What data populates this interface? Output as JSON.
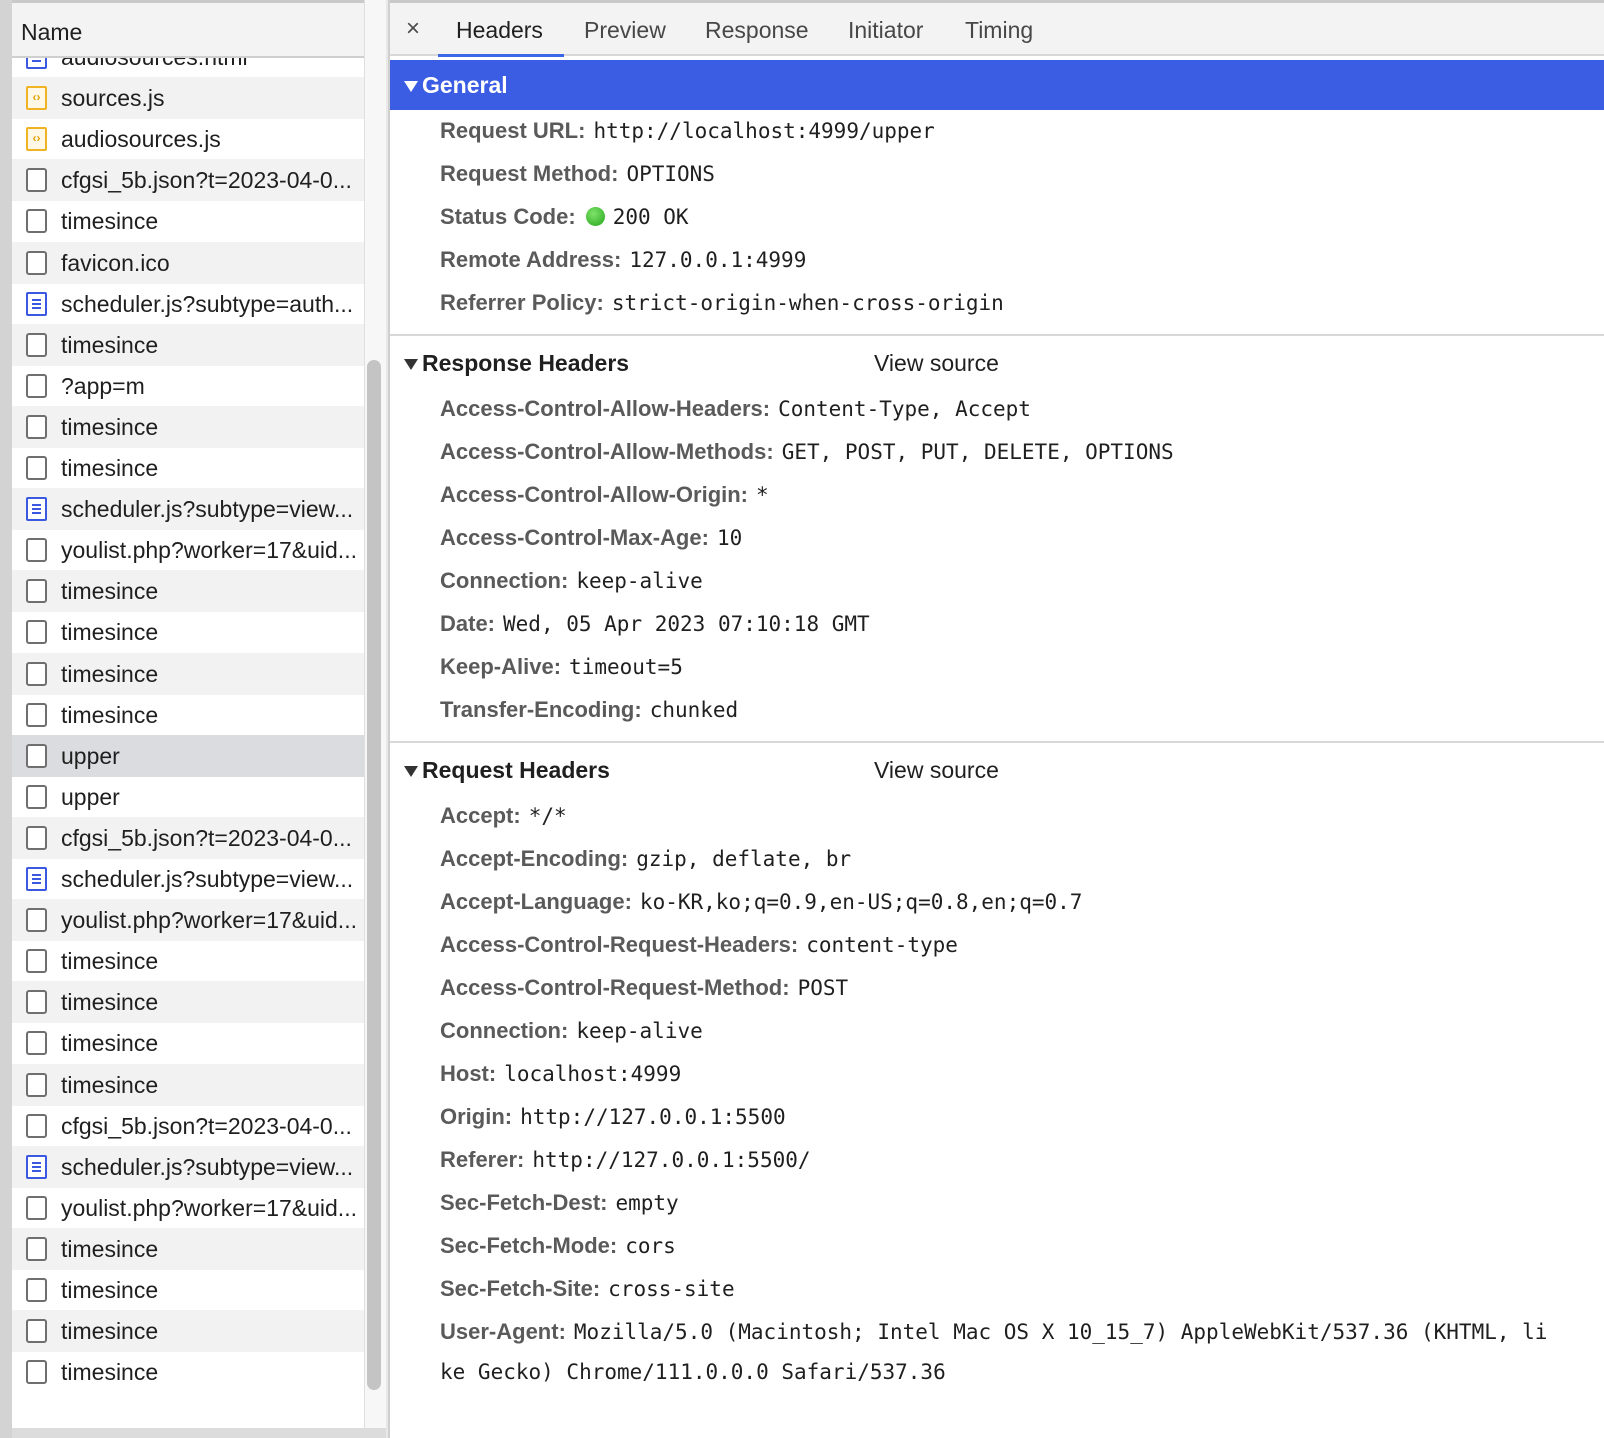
{
  "request_list": {
    "column_header": "Name",
    "rows": [
      {
        "name": "audiosources.html",
        "icon": "document-icon"
      },
      {
        "name": "sources.js",
        "icon": "script-icon"
      },
      {
        "name": "audiosources.js",
        "icon": "script-icon"
      },
      {
        "name": "cfgsi_5b.json?t=2023-04-0...",
        "icon": "blank-file-icon"
      },
      {
        "name": "timesince",
        "icon": "blank-file-icon"
      },
      {
        "name": "favicon.ico",
        "icon": "blank-file-icon"
      },
      {
        "name": "scheduler.js?subtype=auth...",
        "icon": "document-icon"
      },
      {
        "name": "timesince",
        "icon": "blank-file-icon"
      },
      {
        "name": "?app=m",
        "icon": "blank-file-icon"
      },
      {
        "name": "timesince",
        "icon": "blank-file-icon"
      },
      {
        "name": "timesince",
        "icon": "blank-file-icon"
      },
      {
        "name": "scheduler.js?subtype=view...",
        "icon": "document-icon"
      },
      {
        "name": "youlist.php?worker=17&uid...",
        "icon": "blank-file-icon"
      },
      {
        "name": "timesince",
        "icon": "blank-file-icon"
      },
      {
        "name": "timesince",
        "icon": "blank-file-icon"
      },
      {
        "name": "timesince",
        "icon": "blank-file-icon"
      },
      {
        "name": "timesince",
        "icon": "blank-file-icon"
      },
      {
        "name": "upper",
        "icon": "blank-file-icon",
        "selected": true
      },
      {
        "name": "upper",
        "icon": "blank-file-icon"
      },
      {
        "name": "cfgsi_5b.json?t=2023-04-0...",
        "icon": "blank-file-icon"
      },
      {
        "name": "scheduler.js?subtype=view...",
        "icon": "document-icon"
      },
      {
        "name": "youlist.php?worker=17&uid...",
        "icon": "blank-file-icon"
      },
      {
        "name": "timesince",
        "icon": "blank-file-icon"
      },
      {
        "name": "timesince",
        "icon": "blank-file-icon"
      },
      {
        "name": "timesince",
        "icon": "blank-file-icon"
      },
      {
        "name": "timesince",
        "icon": "blank-file-icon"
      },
      {
        "name": "cfgsi_5b.json?t=2023-04-0...",
        "icon": "blank-file-icon"
      },
      {
        "name": "scheduler.js?subtype=view...",
        "icon": "document-icon"
      },
      {
        "name": "youlist.php?worker=17&uid...",
        "icon": "blank-file-icon"
      },
      {
        "name": "timesince",
        "icon": "blank-file-icon"
      },
      {
        "name": "timesince",
        "icon": "blank-file-icon"
      },
      {
        "name": "timesince",
        "icon": "blank-file-icon"
      },
      {
        "name": "timesince",
        "icon": "blank-file-icon"
      }
    ]
  },
  "tabs": {
    "close": "×",
    "items": [
      "Headers",
      "Preview",
      "Response",
      "Initiator",
      "Timing"
    ],
    "active": "Headers"
  },
  "general": {
    "title": "General",
    "request_url_key": "Request URL:",
    "request_url": "http://localhost:4999/upper",
    "method_key": "Request Method:",
    "method": "OPTIONS",
    "status_key": "Status Code:",
    "status": "200 OK",
    "status_color": "#23a51a",
    "remote_key": "Remote Address:",
    "remote": "127.0.0.1:4999",
    "referrer_key": "Referrer Policy:",
    "referrer": "strict-origin-when-cross-origin"
  },
  "response_headers": {
    "title": "Response Headers",
    "view_source": "View source",
    "rows": [
      {
        "k": "Access-Control-Allow-Headers:",
        "v": "Content-Type, Accept"
      },
      {
        "k": "Access-Control-Allow-Methods:",
        "v": "GET, POST, PUT, DELETE, OPTIONS"
      },
      {
        "k": "Access-Control-Allow-Origin:",
        "v": "*"
      },
      {
        "k": "Access-Control-Max-Age:",
        "v": "10"
      },
      {
        "k": "Connection:",
        "v": "keep-alive"
      },
      {
        "k": "Date:",
        "v": "Wed, 05 Apr 2023 07:10:18 GMT"
      },
      {
        "k": "Keep-Alive:",
        "v": "timeout=5"
      },
      {
        "k": "Transfer-Encoding:",
        "v": "chunked"
      }
    ]
  },
  "request_headers": {
    "title": "Request Headers",
    "view_source": "View source",
    "rows": [
      {
        "k": "Accept:",
        "v": "*/*"
      },
      {
        "k": "Accept-Encoding:",
        "v": "gzip, deflate, br"
      },
      {
        "k": "Accept-Language:",
        "v": "ko-KR,ko;q=0.9,en-US;q=0.8,en;q=0.7"
      },
      {
        "k": "Access-Control-Request-Headers:",
        "v": "content-type"
      },
      {
        "k": "Access-Control-Request-Method:",
        "v": "POST"
      },
      {
        "k": "Connection:",
        "v": "keep-alive"
      },
      {
        "k": "Host:",
        "v": "localhost:4999"
      },
      {
        "k": "Origin:",
        "v": "http://127.0.0.1:5500"
      },
      {
        "k": "Referer:",
        "v": "http://127.0.0.1:5500/"
      },
      {
        "k": "Sec-Fetch-Dest:",
        "v": "empty"
      },
      {
        "k": "Sec-Fetch-Mode:",
        "v": "cors"
      },
      {
        "k": "Sec-Fetch-Site:",
        "v": "cross-site"
      },
      {
        "k": "User-Agent:",
        "v": "Mozilla/5.0 (Macintosh; Intel Mac OS X 10_15_7) AppleWebKit/537.36 (KHTML, li"
      }
    ],
    "user_agent_wrap": "ke Gecko) Chrome/111.0.0.0 Safari/537.36"
  }
}
